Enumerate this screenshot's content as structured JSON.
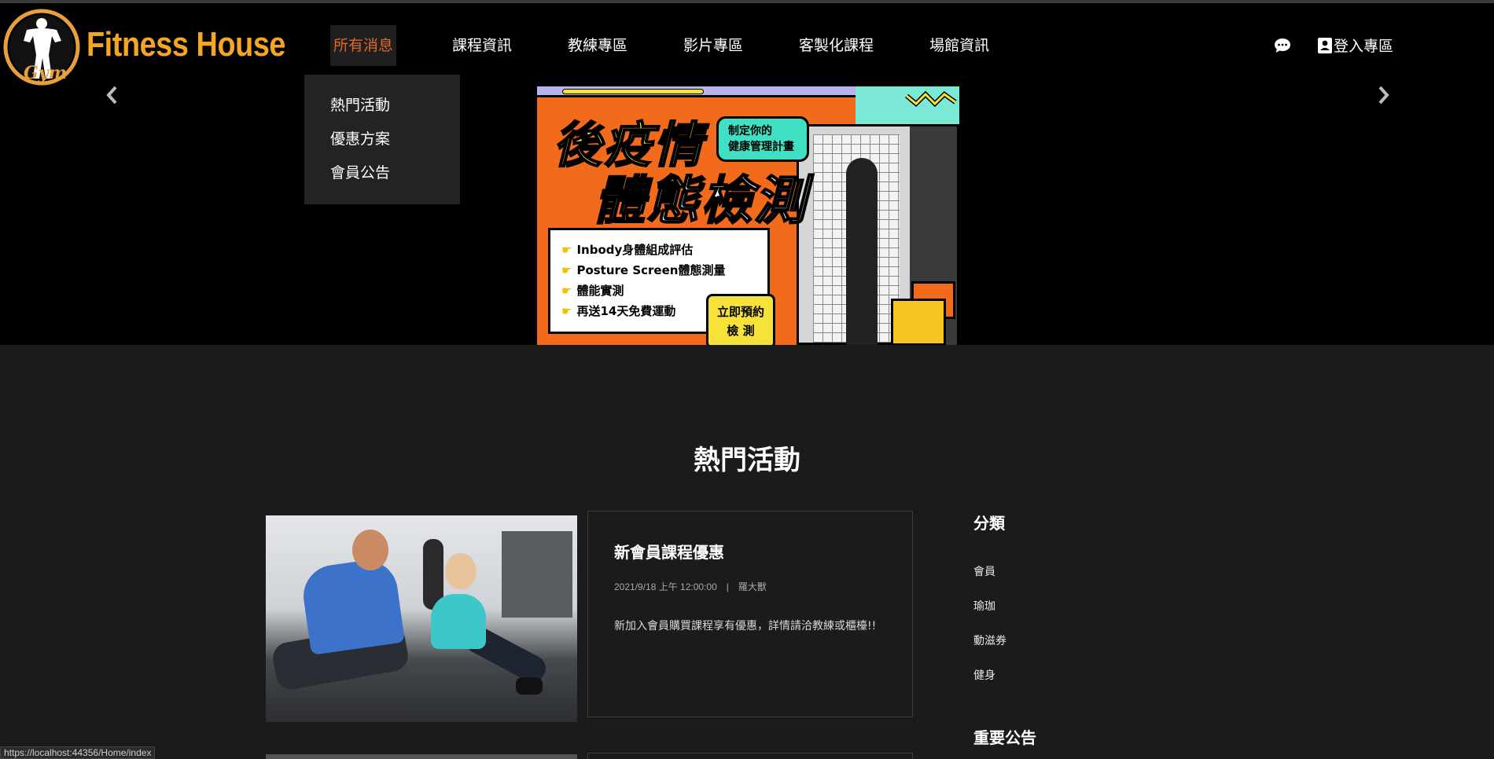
{
  "brand": {
    "name": "Fitness House",
    "emblem_text": "Gym"
  },
  "nav": {
    "items": [
      {
        "label": "所有消息",
        "active": true
      },
      {
        "label": "課程資訊"
      },
      {
        "label": "教練專區"
      },
      {
        "label": "影片專區"
      },
      {
        "label": "客製化課程"
      },
      {
        "label": "場館資訊"
      }
    ],
    "login_label": "登入專區"
  },
  "dropdown": {
    "items": [
      "熱門活動",
      "優惠方案",
      "會員公告"
    ]
  },
  "carousel": {
    "banner": {
      "title_line1": "後疫情",
      "title_line2": "體態檢測",
      "tag_line1": "制定你的",
      "tag_line2": "健康管理計畫",
      "list": [
        "Inbody身體組成評估",
        "Posture Screen體態測量",
        "體能實測",
        "再送14天免費運動"
      ],
      "cta_line1": "立即預約",
      "cta_line2": "檢 測"
    }
  },
  "main": {
    "section_title": "熱門活動",
    "posts": [
      {
        "title": "新會員課程優惠",
        "date": "2021/9/18 上午 12:00:00",
        "author": "羅大獸",
        "description": "新加入會員購買課程享有優惠，詳情請洽教練或櫃檯!!"
      }
    ]
  },
  "sidebar": {
    "categories_heading": "分類",
    "categories": [
      "會員",
      "瑜珈",
      "動滋券",
      "健身"
    ],
    "announcements_heading": "重要公告"
  },
  "status_bar": {
    "url": "https://localhost:44356/Home/index"
  },
  "colors": {
    "brand_orange": "#f5a623",
    "nav_active": "#e0682a",
    "page_bg": "#1b1b1b",
    "hero_bg": "#000000"
  }
}
